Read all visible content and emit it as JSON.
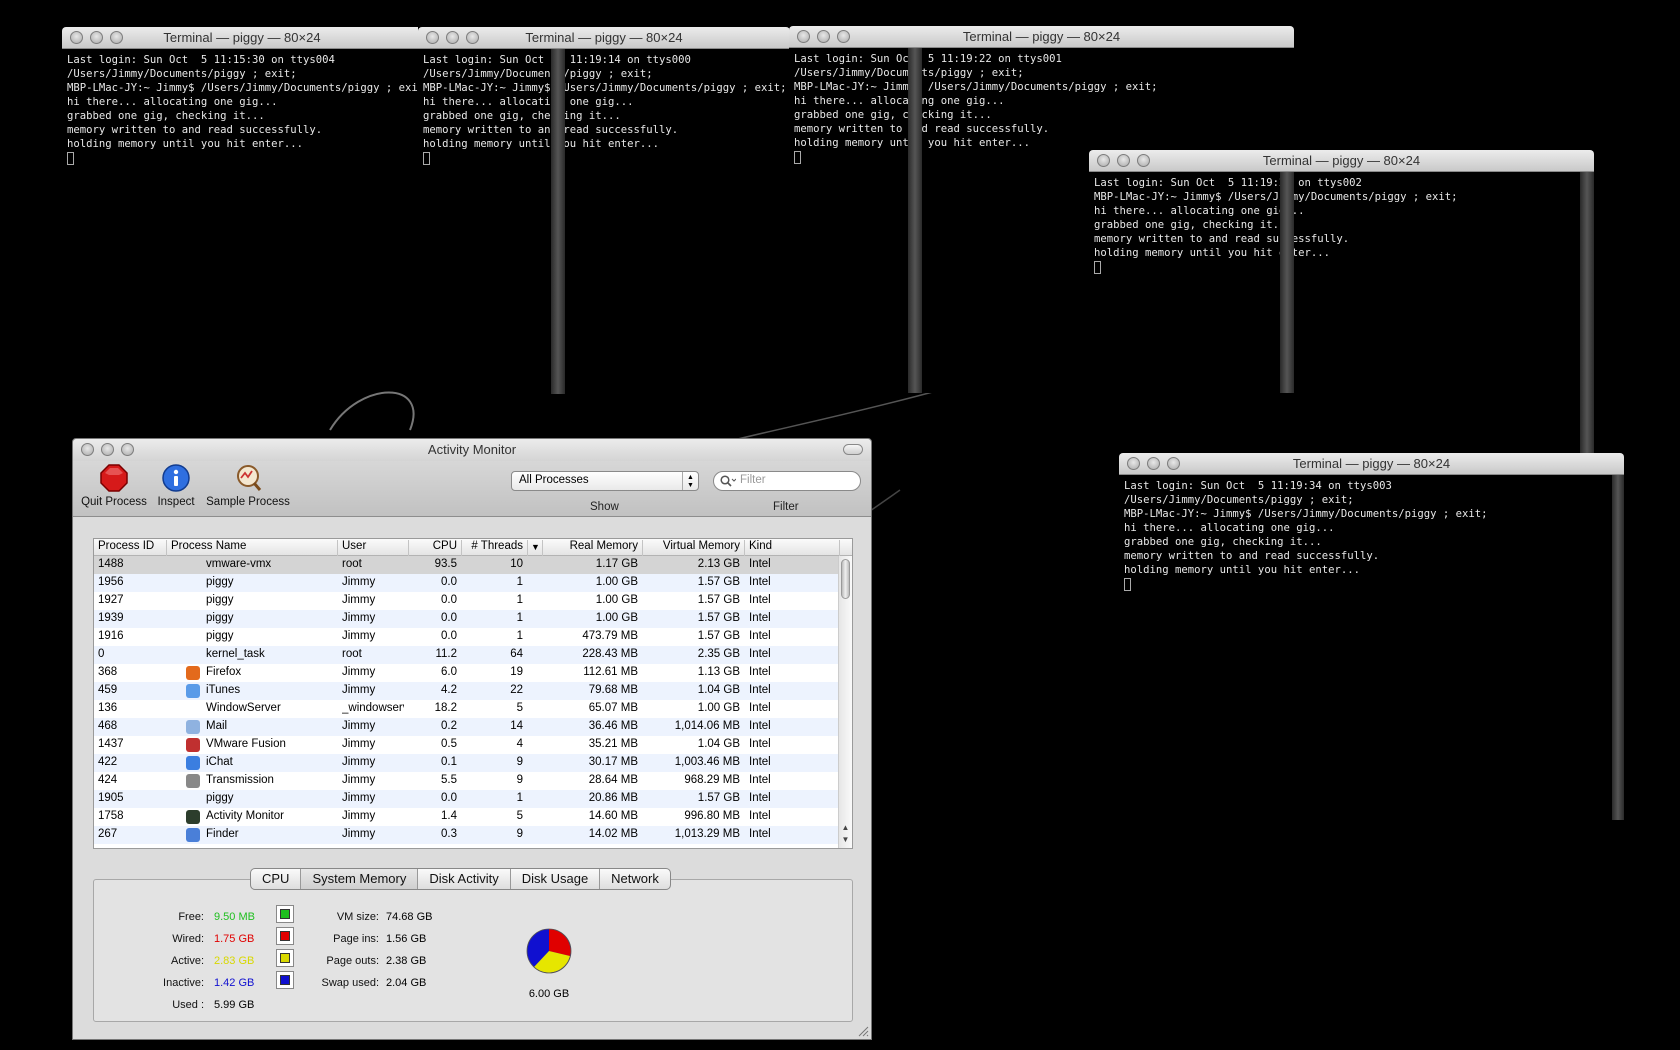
{
  "terminals": [
    {
      "title": "Terminal — piggy — 80×24",
      "lines": [
        "Last login: Sun Oct  5 11:15:30 on ttys004",
        "/Users/Jimmy/Documents/piggy ; exit;",
        "MBP-LMac-JY:~ Jimmy$ /Users/Jimmy/Documents/piggy ; exit;",
        "hi there... allocating one gig...",
        "grabbed one gig, checking it...",
        "memory written to and read successfully.",
        "holding memory until you hit enter..."
      ]
    },
    {
      "title": "Terminal — piggy — 80×24",
      "lines": [
        "Last login: Sun Oct  5 11:19:14 on ttys000",
        "/Users/Jimmy/Documents/piggy ; exit;",
        "MBP-LMac-JY:~ Jimmy$ /Users/Jimmy/Documents/piggy ; exit;",
        "hi there... allocating one gig...",
        "grabbed one gig, checking it...",
        "memory written to and read successfully.",
        "holding memory until you hit enter..."
      ]
    },
    {
      "title": "Terminal — piggy — 80×24",
      "lines": [
        "Last login: Sun Oct  5 11:19:22 on ttys001",
        "/Users/Jimmy/Documents/piggy ; exit;",
        "MBP-LMac-JY:~ Jimmy$ /Users/Jimmy/Documents/piggy ; exit;",
        "hi there... allocating one gig...",
        "grabbed one gig, checking it...",
        "memory written to and read successfully.",
        "holding memory until you hit enter..."
      ]
    },
    {
      "title": "Terminal — piggy — 80×24",
      "lines": [
        "Last login: Sun Oct  5 11:19:28 on ttys002",
        "MBP-LMac-JY:~ Jimmy$ /Users/Jimmy/Documents/piggy ; exit;",
        "hi there... allocating one gig...",
        "grabbed one gig, checking it...",
        "memory written to and read successfully.",
        "holding memory until you hit enter..."
      ]
    },
    {
      "title": "Terminal — piggy — 80×24",
      "lines": [
        "Last login: Sun Oct  5 11:19:34 on ttys003",
        "/Users/Jimmy/Documents/piggy ; exit;",
        "MBP-LMac-JY:~ Jimmy$ /Users/Jimmy/Documents/piggy ; exit;",
        "hi there... allocating one gig...",
        "grabbed one gig, checking it...",
        "memory written to and read successfully.",
        "holding memory until you hit enter..."
      ]
    }
  ],
  "activity_monitor": {
    "title": "Activity Monitor",
    "toolbar": {
      "quit_label": "Quit Process",
      "inspect_label": "Inspect",
      "sample_label": "Sample Process",
      "show_value": "All Processes",
      "show_label": "Show",
      "filter_placeholder": "Filter",
      "filter_label": "Filter"
    },
    "columns": [
      "Process ID",
      "Process Name",
      "User",
      "CPU",
      "# Threads",
      "Real Memory",
      "Virtual Memory",
      "Kind"
    ],
    "rows": [
      {
        "pid": "1488",
        "name": "vmware-vmx",
        "user": "root",
        "cpu": "93.5",
        "threads": "10",
        "real": "1.17 GB",
        "virtual": "2.13 GB",
        "kind": "Intel",
        "icon": ""
      },
      {
        "pid": "1956",
        "name": "piggy",
        "user": "Jimmy",
        "cpu": "0.0",
        "threads": "1",
        "real": "1.00 GB",
        "virtual": "1.57 GB",
        "kind": "Intel",
        "icon": ""
      },
      {
        "pid": "1927",
        "name": "piggy",
        "user": "Jimmy",
        "cpu": "0.0",
        "threads": "1",
        "real": "1.00 GB",
        "virtual": "1.57 GB",
        "kind": "Intel",
        "icon": ""
      },
      {
        "pid": "1939",
        "name": "piggy",
        "user": "Jimmy",
        "cpu": "0.0",
        "threads": "1",
        "real": "1.00 GB",
        "virtual": "1.57 GB",
        "kind": "Intel",
        "icon": ""
      },
      {
        "pid": "1916",
        "name": "piggy",
        "user": "Jimmy",
        "cpu": "0.0",
        "threads": "1",
        "real": "473.79 MB",
        "virtual": "1.57 GB",
        "kind": "Intel",
        "icon": ""
      },
      {
        "pid": "0",
        "name": "kernel_task",
        "user": "root",
        "cpu": "11.2",
        "threads": "64",
        "real": "228.43 MB",
        "virtual": "2.35 GB",
        "kind": "Intel",
        "icon": ""
      },
      {
        "pid": "368",
        "name": "Firefox",
        "user": "Jimmy",
        "cpu": "6.0",
        "threads": "19",
        "real": "112.61 MB",
        "virtual": "1.13 GB",
        "kind": "Intel",
        "icon": "firefox-icon"
      },
      {
        "pid": "459",
        "name": "iTunes",
        "user": "Jimmy",
        "cpu": "4.2",
        "threads": "22",
        "real": "79.68 MB",
        "virtual": "1.04 GB",
        "kind": "Intel",
        "icon": "itunes-icon"
      },
      {
        "pid": "136",
        "name": "WindowServer",
        "user": "_windowserv",
        "cpu": "18.2",
        "threads": "5",
        "real": "65.07 MB",
        "virtual": "1.00 GB",
        "kind": "Intel",
        "icon": ""
      },
      {
        "pid": "468",
        "name": "Mail",
        "user": "Jimmy",
        "cpu": "0.2",
        "threads": "14",
        "real": "36.46 MB",
        "virtual": "1,014.06 MB",
        "kind": "Intel",
        "icon": "mail-icon"
      },
      {
        "pid": "1437",
        "name": "VMware Fusion",
        "user": "Jimmy",
        "cpu": "0.5",
        "threads": "4",
        "real": "35.21 MB",
        "virtual": "1.04 GB",
        "kind": "Intel",
        "icon": "vmware-icon"
      },
      {
        "pid": "422",
        "name": "iChat",
        "user": "Jimmy",
        "cpu": "0.1",
        "threads": "9",
        "real": "30.17 MB",
        "virtual": "1,003.46 MB",
        "kind": "Intel",
        "icon": "ichat-icon"
      },
      {
        "pid": "424",
        "name": "Transmission",
        "user": "Jimmy",
        "cpu": "5.5",
        "threads": "9",
        "real": "28.64 MB",
        "virtual": "968.29 MB",
        "kind": "Intel",
        "icon": "transmission-icon"
      },
      {
        "pid": "1905",
        "name": "piggy",
        "user": "Jimmy",
        "cpu": "0.0",
        "threads": "1",
        "real": "20.86 MB",
        "virtual": "1.57 GB",
        "kind": "Intel",
        "icon": ""
      },
      {
        "pid": "1758",
        "name": "Activity Monitor",
        "user": "Jimmy",
        "cpu": "1.4",
        "threads": "5",
        "real": "14.60 MB",
        "virtual": "996.80 MB",
        "kind": "Intel",
        "icon": "activity-monitor-icon"
      },
      {
        "pid": "267",
        "name": "Finder",
        "user": "Jimmy",
        "cpu": "0.3",
        "threads": "9",
        "real": "14.02 MB",
        "virtual": "1,013.29 MB",
        "kind": "Intel",
        "icon": "finder-icon"
      }
    ],
    "tabs": [
      "CPU",
      "System Memory",
      "Disk Activity",
      "Disk Usage",
      "Network"
    ],
    "active_tab": "System Memory",
    "memory": {
      "free_label": "Free:",
      "free": "9.50 MB",
      "free_color": "#1fbf1f",
      "wired_label": "Wired:",
      "wired": "1.75 GB",
      "wired_color": "#e00000",
      "active_label": "Active:",
      "active": "2.83 GB",
      "active_color": "#d8d800",
      "inactive_label": "Inactive:",
      "inactive": "1.42 GB",
      "inactive_color": "#1010d0",
      "used_label": "Used :",
      "used": "5.99 GB",
      "vm_size_label": "VM size:",
      "vm_size": "74.68 GB",
      "page_ins_label": "Page ins:",
      "page_ins": "1.56 GB",
      "page_outs_label": "Page outs:",
      "page_outs": "2.38 GB",
      "swap_used_label": "Swap used:",
      "swap_used": "2.04 GB",
      "total": "6.00 GB"
    }
  }
}
